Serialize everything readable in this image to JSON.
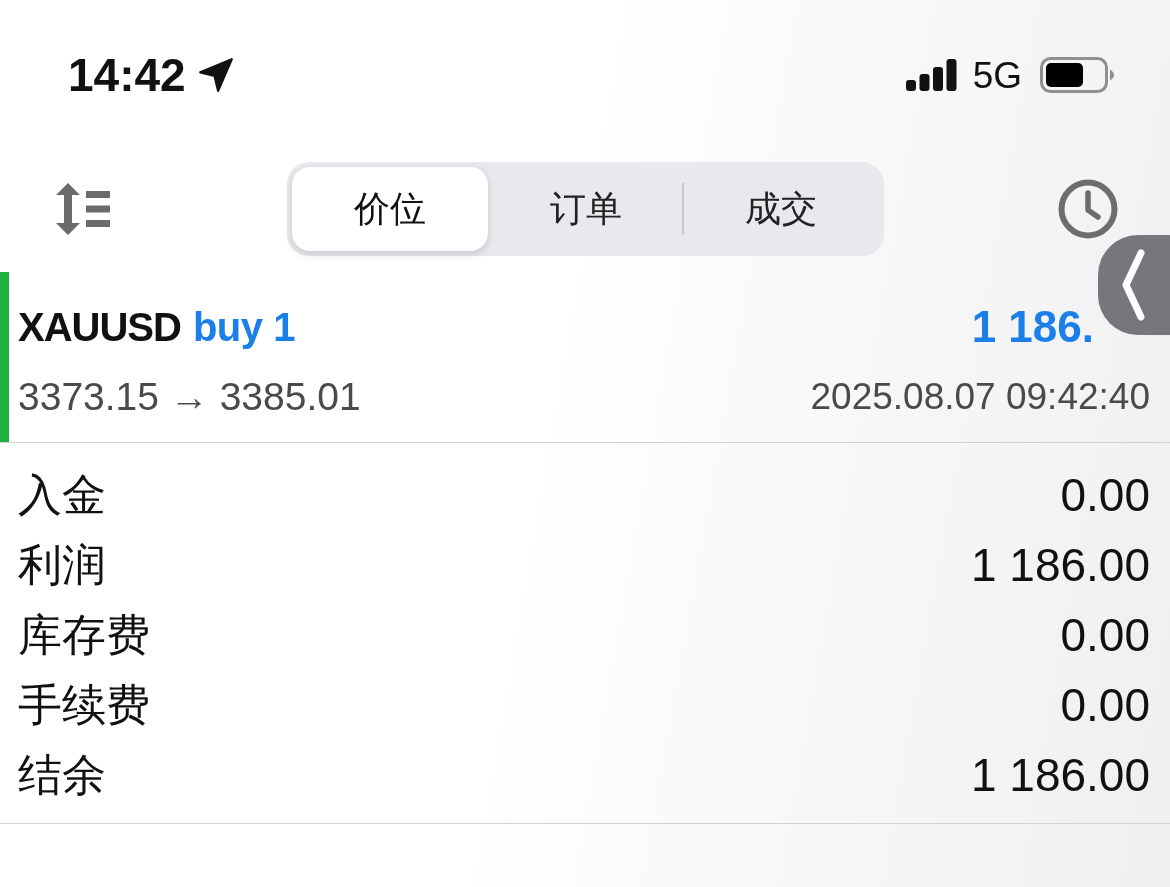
{
  "status_bar": {
    "time": "14:42",
    "network": "5G"
  },
  "tabs": [
    {
      "label": "价位",
      "selected": true
    },
    {
      "label": "订单",
      "selected": false
    },
    {
      "label": "成交",
      "selected": false
    }
  ],
  "deals": [
    {
      "symbol": "XAUUSD",
      "side": "buy 1",
      "profit": "1 186.",
      "prices": "3373.15 → 3385.01",
      "time": "2025.08.07 09:42:40",
      "color": "#1fb141"
    }
  ],
  "summary": [
    {
      "label": "入金",
      "value": "0.00"
    },
    {
      "label": "利润",
      "value": "1 186.00"
    },
    {
      "label": "库存费",
      "value": "0.00"
    },
    {
      "label": "手续费",
      "value": "0.00"
    },
    {
      "label": "结余",
      "value": "1 186.00"
    }
  ]
}
